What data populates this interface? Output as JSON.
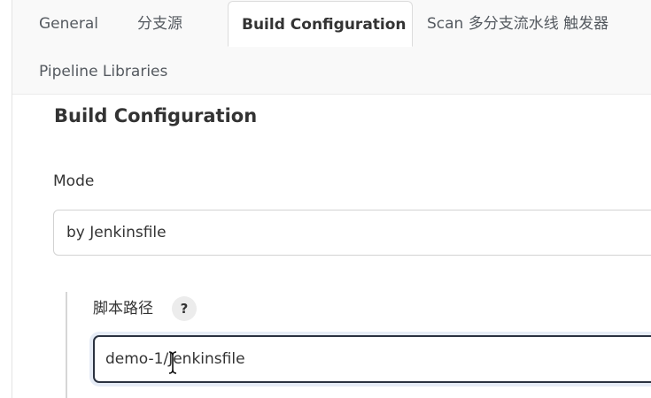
{
  "tabs": [
    {
      "label": "General",
      "active": false
    },
    {
      "label": "分支源",
      "active": false
    },
    {
      "label": "Build Configuration",
      "active": true
    },
    {
      "label": "Scan 多分支流水线 触发器",
      "active": false
    },
    {
      "label": "Pipeline Libraries",
      "active": false
    }
  ],
  "section": {
    "title": "Build Configuration"
  },
  "mode": {
    "label": "Mode",
    "value": "by Jenkinsfile"
  },
  "script_path": {
    "label": "脚本路径",
    "help": "?",
    "value": "demo-1/Jenkinsfile"
  },
  "colors": {
    "tab_background": "#f9f9f9",
    "input_focus_border": "#2b3240",
    "help_icon_background": "#ececec"
  },
  "icons": {
    "help": "help-icon",
    "cursor": "text-cursor-icon"
  }
}
